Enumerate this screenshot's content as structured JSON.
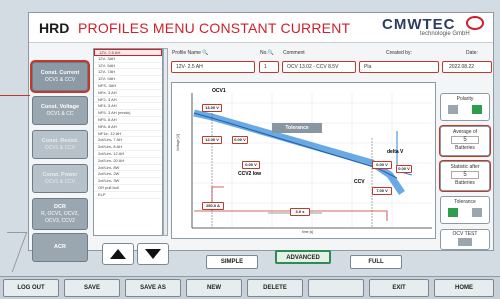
{
  "header": {
    "prefix": "HRD",
    "title": "PROFILES MENU CONSTANT CURRENT",
    "brand": "CMWTEC",
    "brand_sub": "technologie GmbH"
  },
  "left_menu": [
    {
      "title": "Const. Current",
      "sub": "OCV1 & CCV"
    },
    {
      "title": "Const. Voltage",
      "sub": "OCV1 & CC"
    },
    {
      "title": "Const. Resist.",
      "sub": "OCV1 & CCV"
    },
    {
      "title": "Const. Power",
      "sub": "OCV1 & CCV"
    },
    {
      "title": "DCR",
      "sub": "R, OCV1, OCV2, OCV3, CCV2"
    },
    {
      "title": "ACR",
      "sub": ""
    }
  ],
  "profile_list": [
    "12V- 2.5 AH",
    "12V- 3AH",
    "12V- 5AH",
    "12V- 7AH",
    "12V- 9AH",
    "NFS- 3AH",
    "NFe- 3 AH",
    "NF2- 3 AH",
    "NF4- 3 AH",
    "NF5- 3 AH (mndo)",
    "NF5- 8 AH",
    "NF8- 8 AH",
    "NF1e- 12 AH",
    "2cf/Lim- 7 AH",
    "2cf/Lim- 8 AH",
    "2cf/Lim- 12 AH",
    "2cf/Lim- 20 AH",
    "2cf/Lim- 8W",
    "2cf/Lim- 2W",
    "2cf/Lim- 3W",
    "OR pull bull",
    "ELP"
  ],
  "fields": {
    "profile_name_label": "Profile Name",
    "profile_name": "12V- 2.5 AH",
    "no_label": "No.",
    "no": "1",
    "comment_label": "Comment",
    "comment": "OCV 13.02 - CCV 8.5V",
    "created_label": "Created by:",
    "created": "Pla",
    "date_label": "Date:",
    "date": "2022.08.22"
  },
  "chart": {
    "ocv1": "OCV1",
    "ocv1_val": "13.00 V",
    "ccv2_low": "CCV2 low",
    "ccv": "CCV",
    "delta_v": "delta V",
    "tolerance": "Tolerance",
    "ylabel": "Voltage [V]",
    "xlabel": "time [s]",
    "v1": "12.00 V",
    "v2": "0.00 V",
    "v3": "0.00 V",
    "v4": "0.00 V",
    "v5": "7.00 V",
    "v6": "0.00 V",
    "i1": "250.0 A",
    "t1": "3.0 s"
  },
  "modes": {
    "simple": "SIMPLE",
    "advanced": "ADVANCED",
    "full": "FULL"
  },
  "right": {
    "polarity": "Polarity",
    "average": "Average of",
    "average_val": "5",
    "batteries": "Batteries",
    "statistic": "Statistic after",
    "statistic_val": "5",
    "batteries2": "Batteries",
    "tolerance": "Tolerance",
    "ocv_test": "OCV TEST"
  },
  "toolbar": [
    "LOG OUT",
    "SAVE",
    "SAVE AS",
    "NEW",
    "DELETE",
    "",
    "EXIT",
    "HOME"
  ]
}
